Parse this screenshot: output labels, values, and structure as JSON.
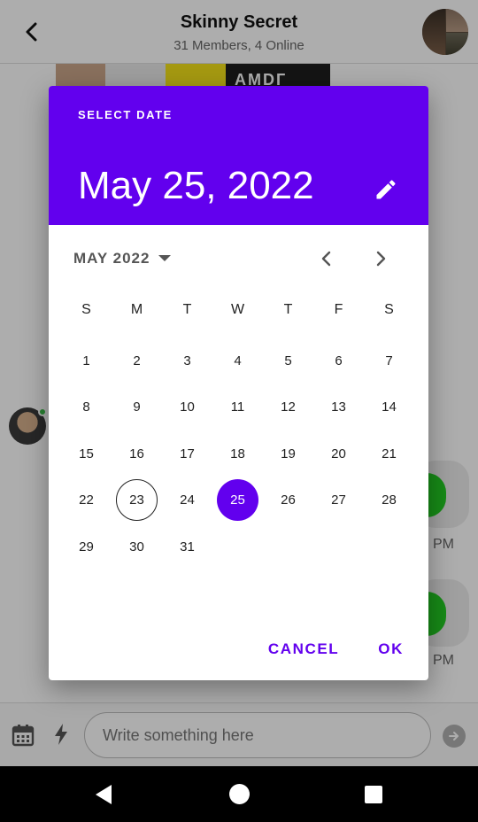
{
  "chat": {
    "title": "Skinny Secret",
    "subtitle": "31 Members, 4 Online",
    "media_text": "AMDГ",
    "times": [
      "PM",
      "PM"
    ],
    "composer_placeholder": "Write something here"
  },
  "date_picker": {
    "label": "SELECT DATE",
    "selected_date_text": "May 25, 2022",
    "month_label": "MAY 2022",
    "weekdays": [
      "S",
      "M",
      "T",
      "W",
      "T",
      "F",
      "S"
    ],
    "first_weekday_offset": 0,
    "days_in_month": 31,
    "today": 23,
    "selected": 25,
    "cancel_label": "CANCEL",
    "ok_label": "OK"
  },
  "colors": {
    "accent": "#6200ee",
    "online": "#3bbf4a"
  },
  "icons": {
    "back": "chevron-left-icon",
    "edit": "pencil-icon",
    "dropdown": "caret-down-icon",
    "prev": "chevron-left-icon",
    "next": "chevron-right-icon",
    "calendar": "calendar-icon",
    "bolt": "lightning-icon",
    "send": "arrow-right-icon"
  }
}
